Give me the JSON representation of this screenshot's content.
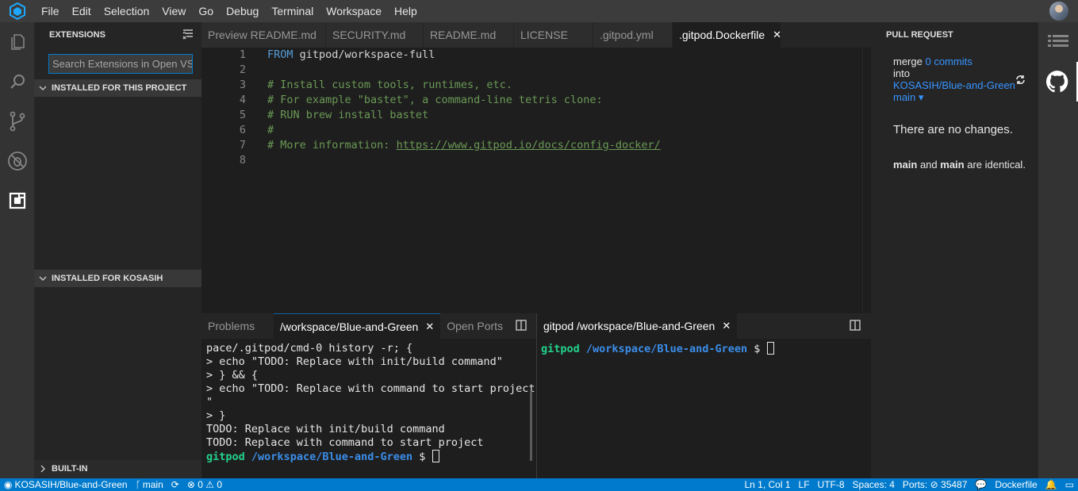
{
  "colors": {
    "accent": "#007acc",
    "link": "#3794ff",
    "terminal_green": "#23d18b",
    "terminal_blue": "#3b8eea"
  },
  "menu": [
    "File",
    "Edit",
    "Selection",
    "View",
    "Go",
    "Debug",
    "Terminal",
    "Workspace",
    "Help"
  ],
  "activity_left": [
    "files-icon",
    "search-icon",
    "source-control-icon",
    "debug-icon",
    "extensions-icon"
  ],
  "activity_right": [
    "list-icon",
    "github-icon"
  ],
  "extensions": {
    "title": "EXTENSIONS",
    "search_placeholder": "Search Extensions in Open VSX",
    "sections": {
      "project": "INSTALLED FOR THIS PROJECT",
      "user": "INSTALLED FOR KOSASIH",
      "builtin": "BUILT-IN"
    }
  },
  "tabs": [
    {
      "label": "Preview README.md",
      "active": false
    },
    {
      "label": "SECURITY.md",
      "active": false
    },
    {
      "label": "README.md",
      "active": false
    },
    {
      "label": "LICENSE",
      "active": false
    },
    {
      "label": ".gitpod.yml",
      "active": false
    },
    {
      "label": ".gitpod.Dockerfile",
      "active": true
    }
  ],
  "editor": {
    "lines": [
      {
        "num": "1",
        "kw": "FROM",
        "text": " gitpod/workspace-full"
      },
      {
        "num": "2",
        "comment": ""
      },
      {
        "num": "3",
        "comment": "# Install custom tools, runtimes, etc."
      },
      {
        "num": "4",
        "comment": "# For example \"bastet\", a command-line tetris clone:"
      },
      {
        "num": "5",
        "comment": "# RUN brew install bastet"
      },
      {
        "num": "6",
        "comment": "#"
      },
      {
        "num": "7",
        "comment": "# More information: ",
        "link": "https://www.gitpod.io/docs/config-docker/"
      },
      {
        "num": "8",
        "comment": ""
      }
    ]
  },
  "panel_left": {
    "tabs": [
      "Problems",
      "/workspace/Blue-and-Green",
      "Open Ports"
    ],
    "lines": [
      "pace/.gitpod/cmd-0 history -r; {",
      "> echo \"TODO: Replace with init/build command\"",
      "> } && {",
      "> echo \"TODO: Replace with command to start project",
      "\"",
      "> }",
      "TODO: Replace with init/build command",
      "TODO: Replace with command to start project"
    ],
    "prompt_user": "gitpod",
    "prompt_path": "/workspace/Blue-and-Green",
    "prompt_symbol": "$"
  },
  "panel_right": {
    "tab": "gitpod /workspace/Blue-and-Green",
    "prompt_user": "gitpod",
    "prompt_path": "/workspace/Blue-and-Green",
    "prompt_symbol": "$"
  },
  "pull_request": {
    "title": "PULL REQUEST",
    "merge": "merge",
    "commits": "0 commits",
    "into": "into",
    "repo": "KOSASIH/Blue-and-Green",
    "branch": "main",
    "no_changes": "There are no changes.",
    "identical_a": "main",
    "identical_and": " and ",
    "identical_b": "main",
    "identical_rest": " are identical."
  },
  "status": {
    "repo": "KOSASIH/Blue-and-Green",
    "branch": "main",
    "errors": "0",
    "warnings": "0",
    "position": "Ln 1, Col 1",
    "eol": "LF",
    "encoding": "UTF-8",
    "spaces": "Spaces: 4",
    "ports_label": "Ports:",
    "ports": "35487",
    "language": "Dockerfile"
  }
}
